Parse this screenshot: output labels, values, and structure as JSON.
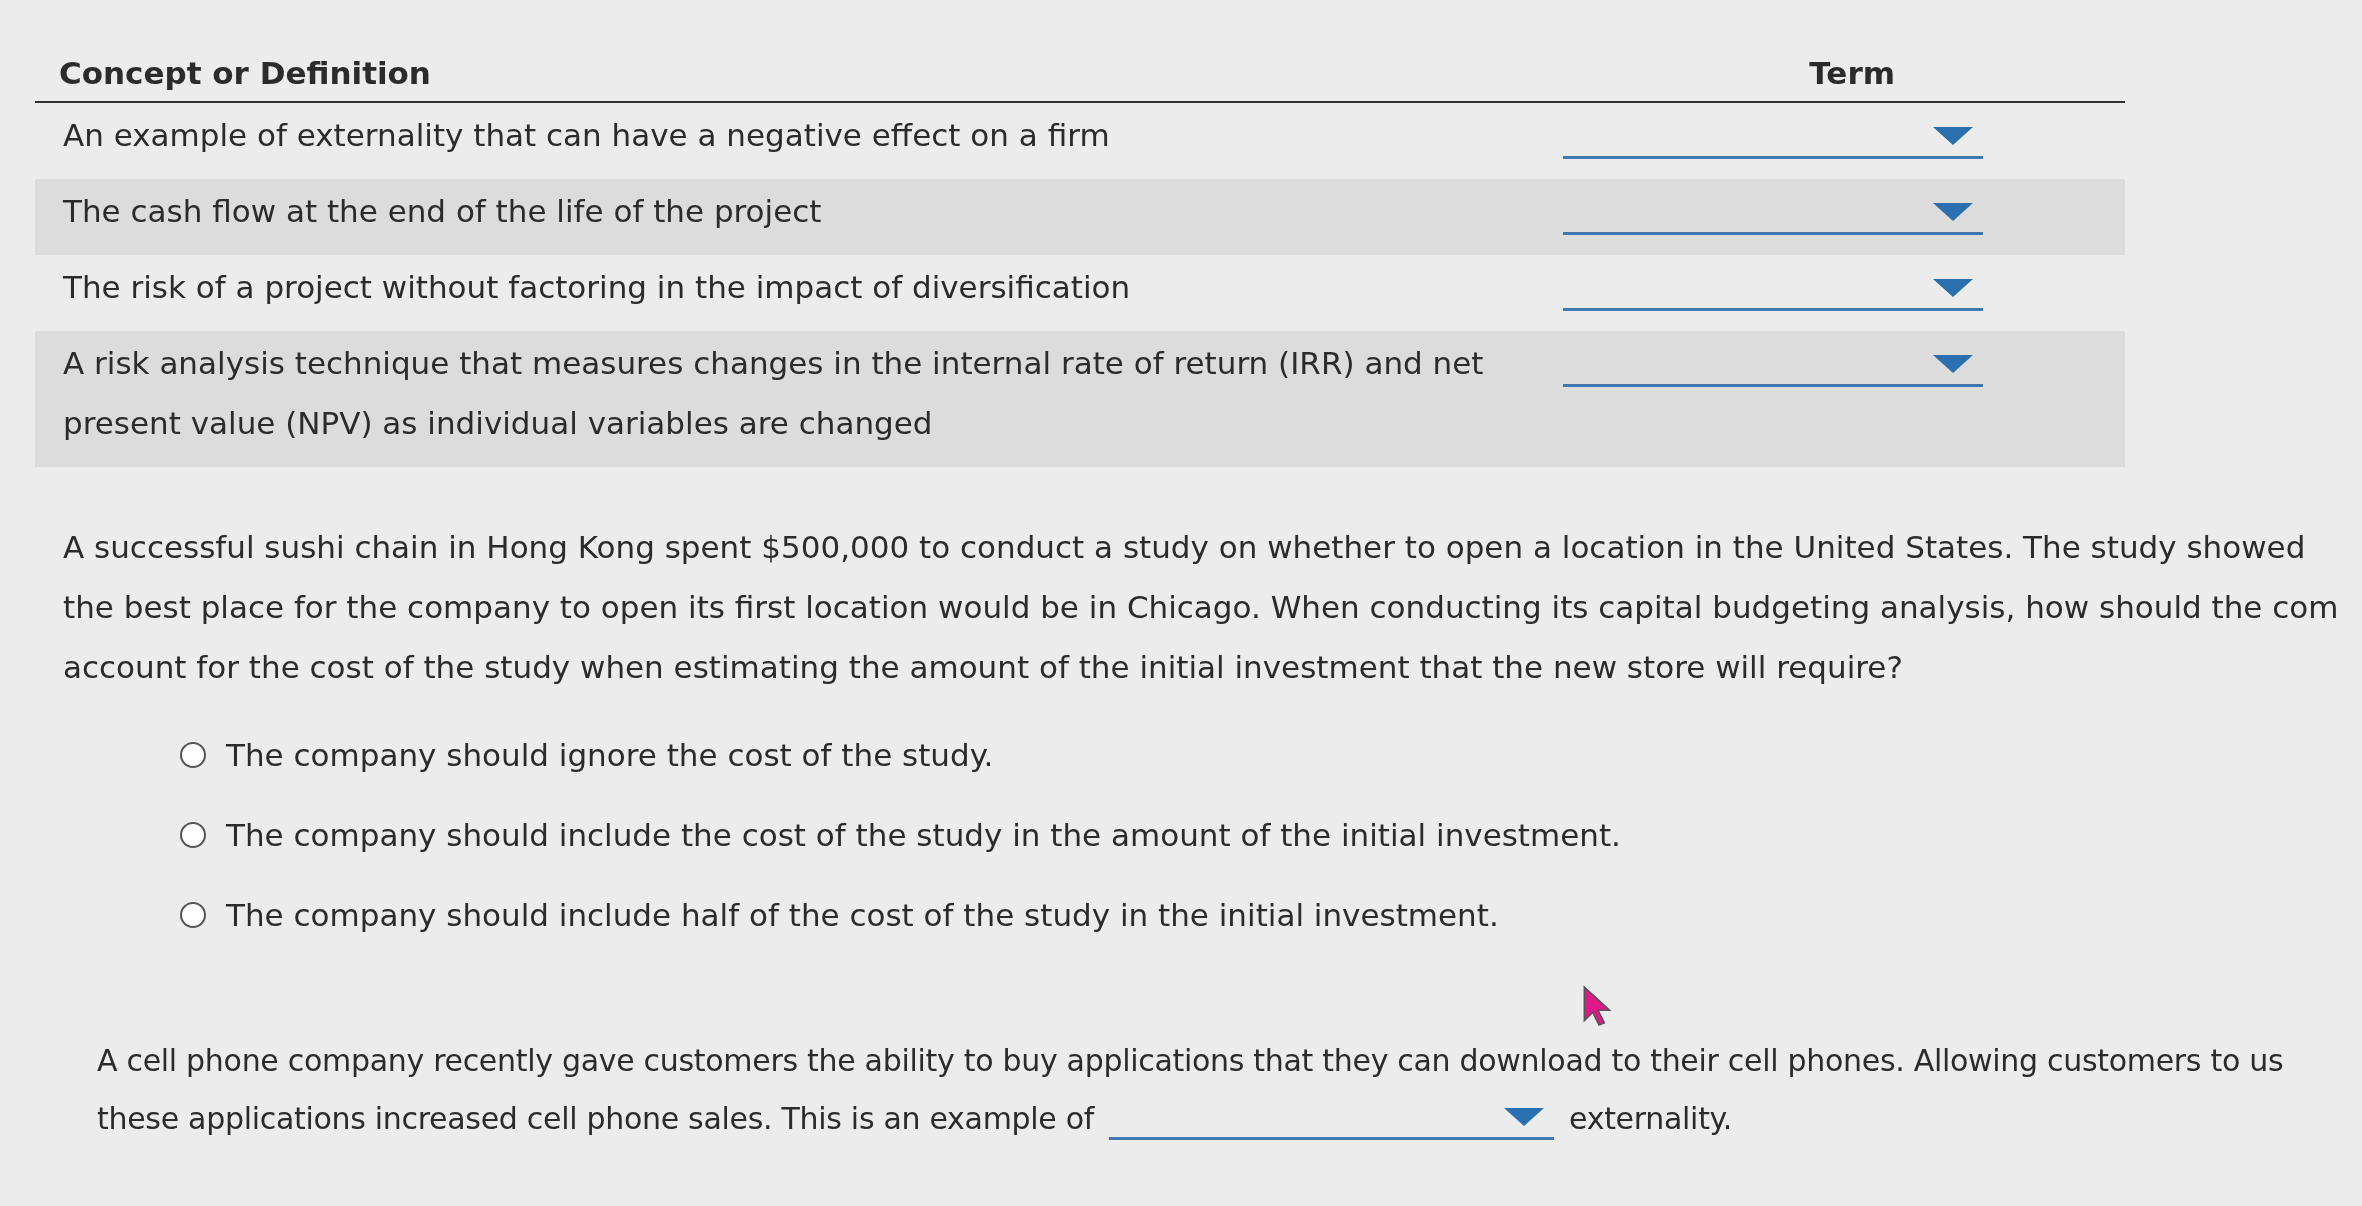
{
  "matching": {
    "columns": [
      "Concept or Definition",
      "Term"
    ],
    "rows": [
      {
        "definition": "An example of externality that can have a negative effect on a firm"
      },
      {
        "definition": "The cash flow at the end of the life of the project"
      },
      {
        "definition": "The risk of a project without factoring in the impact of diversification"
      },
      {
        "definition": "A risk analysis technique that measures changes in the internal rate of return (IRR) and net present value (NPV) as individual variables are changed"
      }
    ]
  },
  "question_1": {
    "text": "A successful sushi chain in Hong Kong spent $500,000 to conduct a study on whether to open a location in the United States. The study showed the best place for the company to open its first location would be in Chicago. When conducting its capital budgeting analysis, how should the com account for the cost of the study when estimating the amount of the initial investment that the new store will require?",
    "options": [
      {
        "label": "The company should ignore the cost of the study.",
        "selected": false
      },
      {
        "label": "The company should include the cost of the study in the amount of the initial investment.",
        "selected": false
      },
      {
        "label": "The company should include half of the cost of the study in the initial investment.",
        "selected": false
      }
    ]
  },
  "question_2": {
    "text_line_1": "A cell phone company recently gave customers the ability to buy applications that they can download to their cell phones. Allowing customers to us",
    "text_before": "these applications increased cell phone sales. This is an example of",
    "text_after": "externality."
  }
}
